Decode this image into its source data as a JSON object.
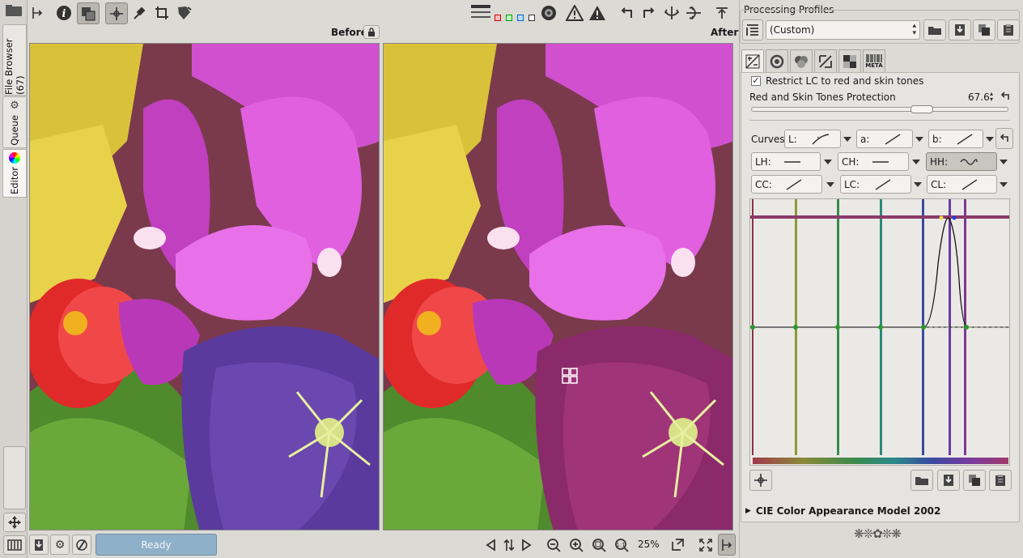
{
  "left_tabs": {
    "file_browser": "File Browser (67)",
    "queue": "Queue",
    "editor": "Editor"
  },
  "preview": {
    "before_label": "Before",
    "after_label": "After"
  },
  "status": {
    "text": "Ready",
    "zoom": "25%"
  },
  "profiles": {
    "title": "Processing Profiles",
    "selected": "(Custom)"
  },
  "tool_tabs": {
    "meta": "META"
  },
  "lc": {
    "restrict_label": "Restrict LC to red and skin tones",
    "protection_label": "Red and Skin Tones Protection",
    "protection_value": "67.6",
    "curves_label": "Curves:",
    "curves": [
      {
        "name": "L:"
      },
      {
        "name": "a:"
      },
      {
        "name": "b:"
      },
      {
        "name": "LH:"
      },
      {
        "name": "CH:"
      },
      {
        "name": "HH:"
      },
      {
        "name": "CC:"
      },
      {
        "name": "LC:"
      },
      {
        "name": "CL:"
      }
    ]
  },
  "ciecam": {
    "label": "CIE Color Appearance Model 2002"
  },
  "icons": [
    "layout-toggle-icon",
    "info-icon",
    "before-after-icon",
    "hand-icon",
    "color-picker-icon",
    "crop-icon",
    "transform-icon",
    "warning-icon",
    "rotate-left-icon",
    "rotate-right-icon",
    "flip-h-icon",
    "flip-v-icon",
    "top-panel-icon",
    "folder-icon",
    "save-icon",
    "copy-icon",
    "paste-icon",
    "zoom-out-icon",
    "zoom-in-icon",
    "zoom-fit-icon",
    "zoom-100-icon",
    "new-window-icon",
    "fullscreen-icon"
  ],
  "colors": {
    "accent_status": "#8fb0c9",
    "curve_bg": "#ebe9e6"
  }
}
